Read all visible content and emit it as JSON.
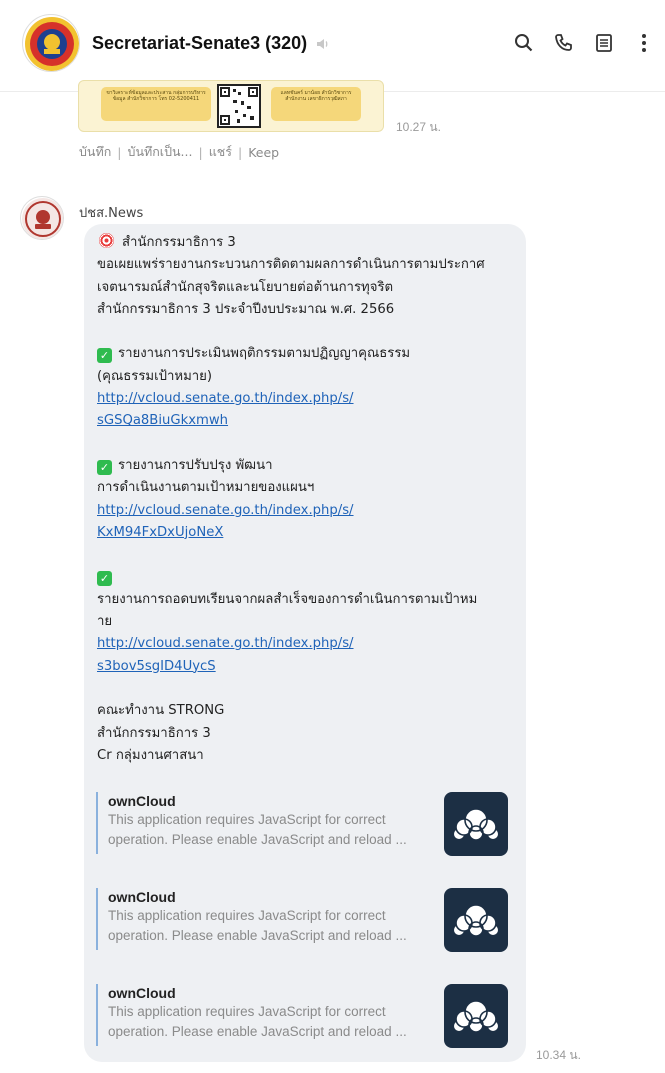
{
  "header": {
    "title": "Secretariat-Senate3 (320)",
    "icons": [
      "search-icon",
      "phone-icon",
      "notes-icon",
      "more-icon"
    ]
  },
  "previous_message": {
    "box1_text": "ขาวิเคราะห์ข้อมูลและประสาน กลุ่มการบริหารข้อมูล สำนักวิชาการ โทร 02-5200411",
    "box2_text": "แลทชันคร์ มาน้อย สำนักวิชาการ สำนักงาน เลขาธิการวุฒิสภา",
    "time": "10.27 น.",
    "actions": [
      "บันทึก",
      "บันทึกเป็น...",
      "แชร์",
      "Keep"
    ]
  },
  "message": {
    "sender": "ปชส.News",
    "time": "10.34 น.",
    "lines": {
      "l1": "สำนักกรรมาธิการ 3",
      "l2": "ขอเผยแพร่รายงานกระบวนการติดตามผลการดำเนินการตามประกาศ",
      "l3": "เจตนารมณ์สำนักสุจริตและนโยบายต่อต้านการทุจริต",
      "l4": "สำนักกรรมาธิการ 3 ประจำปีงบประมาณ พ.ศ. 2566",
      "r1a": "รายงานการประเมินพฤติกรรมตามปฏิญญาคุณธรรม",
      "r1b": "(คุณธรรมเป้าหมาย)",
      "link1a": "http://vcloud.senate.go.th/index.php/s/",
      "link1b": "sGSQa8BiuGkxmwh",
      "r2a": "รายงานการปรับปรุง พัฒนา",
      "r2b": "การดำเนินงานตามเป้าหมายของแผนฯ",
      "link2a": "http://vcloud.senate.go.th/index.php/s/",
      "link2b": "KxM94FxDxUjoNeX",
      "r3a": "รายงานการถอดบทเรียนจากผลสำเร็จของการดำเนินการตามเป้าหม",
      "r3b": "าย",
      "link3a": "http://vcloud.senate.go.th/index.php/s/",
      "link3b": "s3bov5sgID4UycS",
      "f1": "คณะทำงาน STRONG",
      "f2": "สำนักกรรมาธิการ 3",
      "f3": "Cr กลุ่มงานศาสนา"
    },
    "previews": [
      {
        "title": "ownCloud",
        "desc1": "This application requires JavaScript for correct",
        "desc2": "operation. Please enable JavaScript and reload ..."
      },
      {
        "title": "ownCloud",
        "desc1": "This application requires JavaScript for correct",
        "desc2": "operation. Please enable JavaScript and reload ..."
      },
      {
        "title": "ownCloud",
        "desc1": "This application requires JavaScript for correct",
        "desc2": "operation. Please enable JavaScript and reload ..."
      }
    ]
  },
  "colors": {
    "bubble": "#eef0f3",
    "link": "#1f63b8",
    "check": "#2fbb4f",
    "thumb": "#1c2f44"
  }
}
